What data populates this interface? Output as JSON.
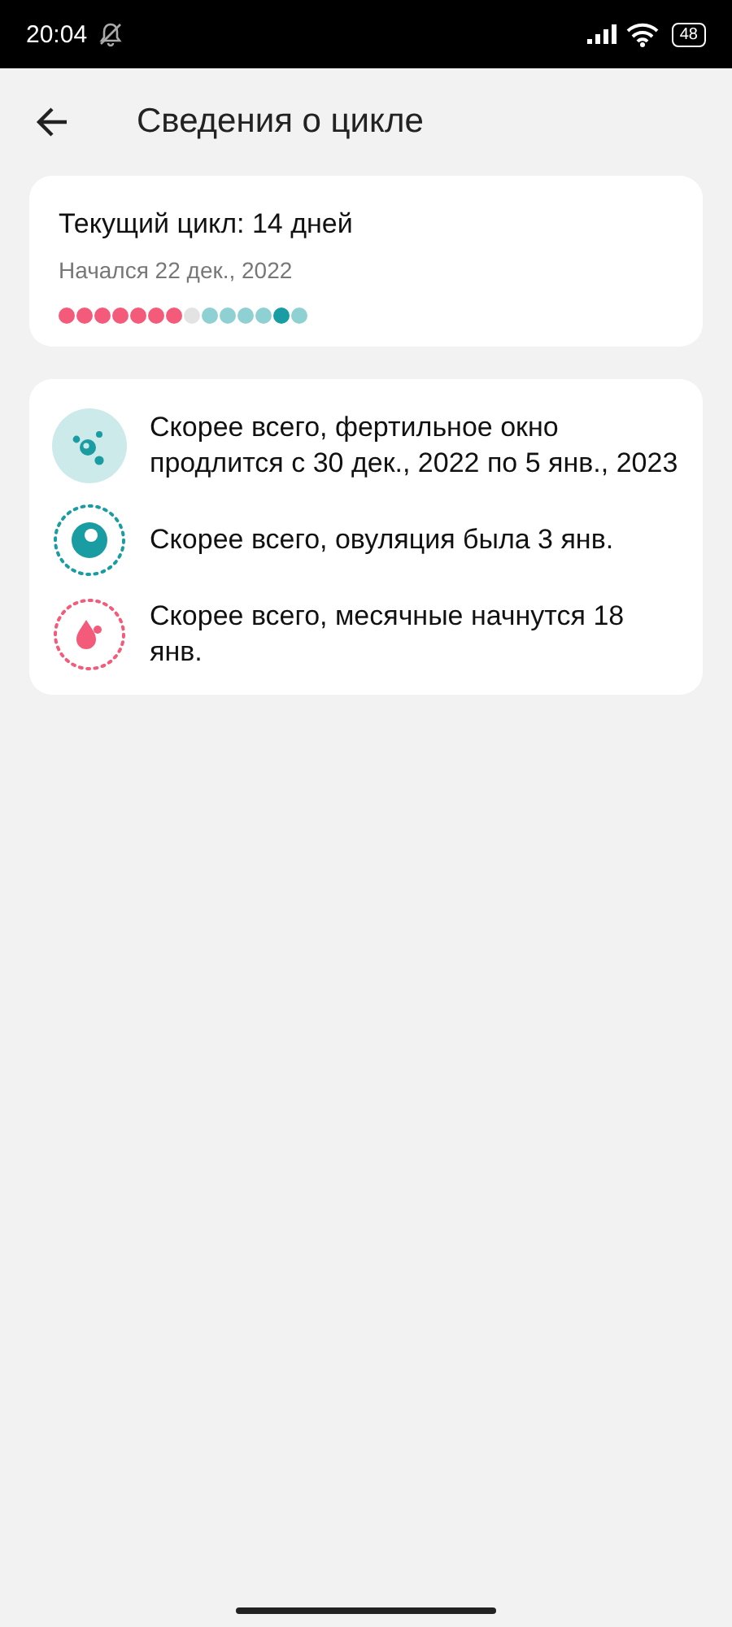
{
  "status_bar": {
    "time": "20:04",
    "battery": "48"
  },
  "header": {
    "title": "Сведения о цикле"
  },
  "cycle": {
    "title": "Текущий цикл: 14 дней",
    "started": "Начался 22 дек., 2022",
    "days": [
      {
        "color": "#f45b7a"
      },
      {
        "color": "#f45b7a"
      },
      {
        "color": "#f45b7a"
      },
      {
        "color": "#f45b7a"
      },
      {
        "color": "#f45b7a"
      },
      {
        "color": "#f45b7a"
      },
      {
        "color": "#f45b7a"
      },
      {
        "color": "#e3e3e3"
      },
      {
        "color": "#8fd0d3"
      },
      {
        "color": "#8fd0d3"
      },
      {
        "color": "#8fd0d3"
      },
      {
        "color": "#8fd0d3"
      },
      {
        "color": "#1a9ca3"
      },
      {
        "color": "#8fd0d3"
      }
    ]
  },
  "predictions": [
    {
      "kind": "fertile",
      "text": "Скорее всего, фертильное окно продлится с 30 дек., 2022 по 5 янв., 2023"
    },
    {
      "kind": "ovulation",
      "text": "Скорее всего, овуляция была 3 янв."
    },
    {
      "kind": "period",
      "text": "Скорее всего, месячные начнутся 18 янв."
    }
  ]
}
